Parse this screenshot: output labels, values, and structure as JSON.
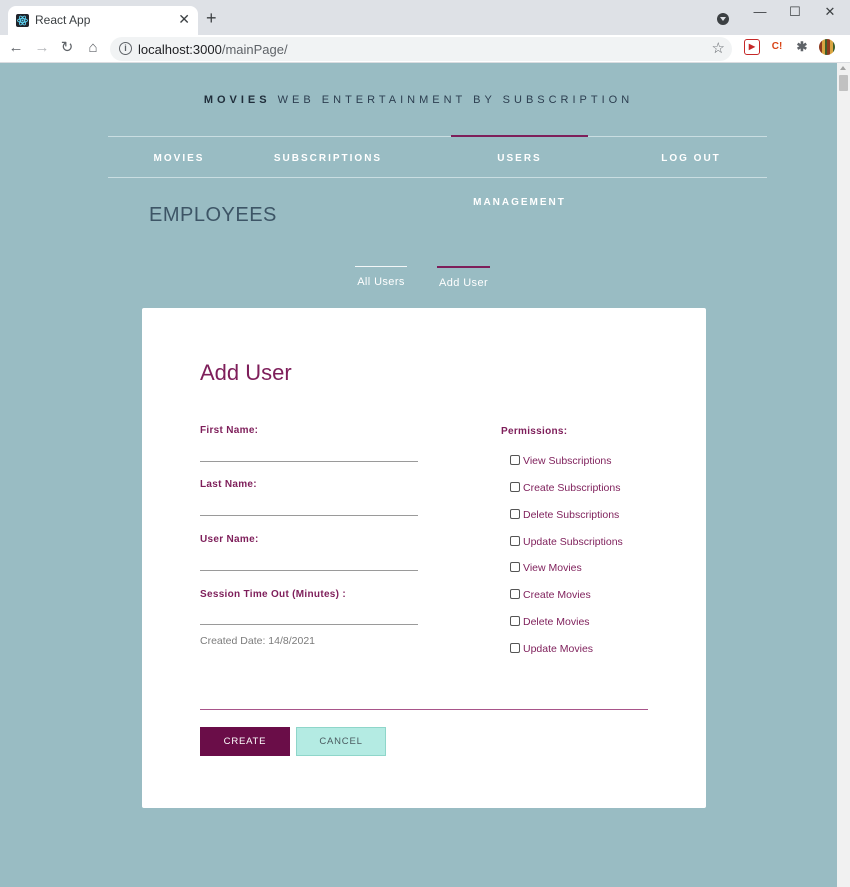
{
  "browser": {
    "tab_title": "React App",
    "tab_close": "✕",
    "new_tab": "+",
    "url_host": "localhost:3000",
    "url_path": "/mainPage/",
    "window_min": "—",
    "window_max": "☐",
    "window_close": "✕",
    "back_icon": "←",
    "forward_icon": "→",
    "reload_icon": "↻",
    "home_icon": "⌂",
    "star_icon": "☆",
    "ext1": "▶",
    "ext2": "C!",
    "ext3": "✱"
  },
  "brand": {
    "bold": "MOVIES",
    "tagline": "WEB ENTERTAINMENT BY SUBSCRIPTION"
  },
  "nav": {
    "items": [
      {
        "label": "MOVIES"
      },
      {
        "label": "SUBSCRIPTIONS"
      },
      {
        "label": "USERS MANAGEMENT",
        "active": true
      },
      {
        "label": "LOG OUT"
      }
    ]
  },
  "section_title": "EMPLOYEES",
  "subtabs": [
    {
      "label": "All Users"
    },
    {
      "label": "Add User",
      "active": true
    }
  ],
  "form": {
    "title": "Add User",
    "fields": [
      {
        "label": "First Name:",
        "value": ""
      },
      {
        "label": "Last Name:",
        "value": ""
      },
      {
        "label": "User Name:",
        "value": ""
      },
      {
        "label": "Session Time Out (Minutes) :",
        "value": ""
      }
    ],
    "created_date": "Created Date: 14/8/2021",
    "permissions_label": "Permissions:",
    "permissions": [
      {
        "label": "View Subscriptions",
        "checked": false
      },
      {
        "label": "Create Subscriptions",
        "checked": false
      },
      {
        "label": "Delete Subscriptions",
        "checked": false
      },
      {
        "label": "Update Subscriptions",
        "checked": false
      },
      {
        "label": "View Movies",
        "checked": false
      },
      {
        "label": "Create Movies",
        "checked": false
      },
      {
        "label": "Delete Movies",
        "checked": false
      },
      {
        "label": "Update Movies",
        "checked": false
      }
    ],
    "create_label": "CREATE",
    "cancel_label": "CANCEL"
  },
  "colors": {
    "page_bg": "#99bcc3",
    "accent": "#7e1e5a",
    "create_bg": "#6a0d48",
    "cancel_bg": "#b4ebe3"
  }
}
